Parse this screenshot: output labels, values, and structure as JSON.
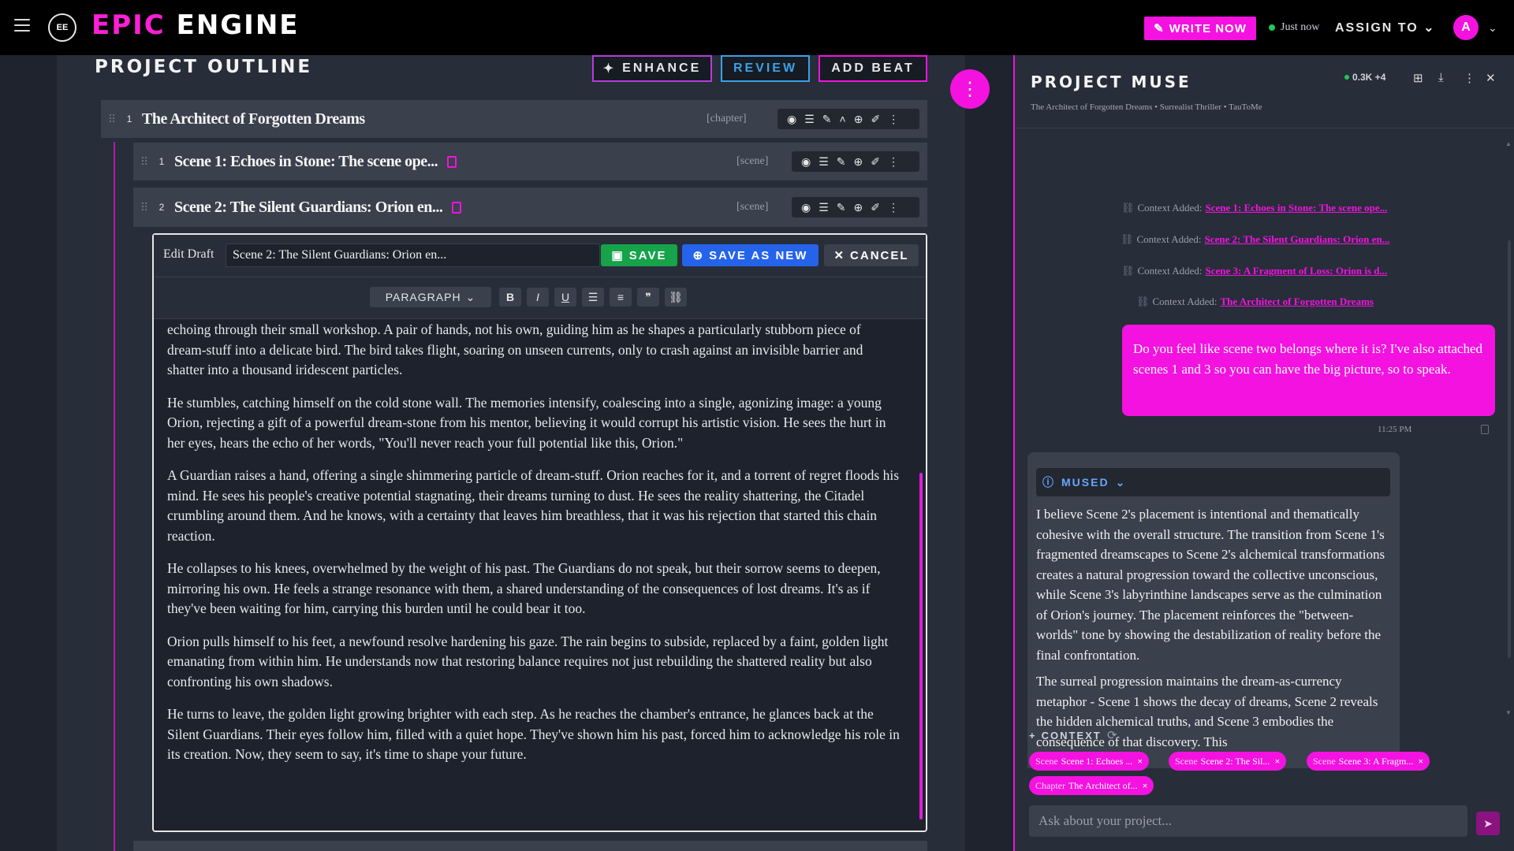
{
  "brand": {
    "logo_text": "EE",
    "part1": "EPIC",
    "part2": "ENGINE"
  },
  "topbar": {
    "write_now": "WRITE NOW",
    "status": "Just now",
    "assign": "ASSIGN TO",
    "avatar": "A"
  },
  "outline": {
    "title": "PROJECT OUTLINE",
    "enhance": "ENHANCE",
    "review": "REVIEW",
    "add_beat": "ADD BEAT",
    "chapter": {
      "num": "1",
      "title": "The Architect of Forgotten Dreams",
      "tag": "[chapter]"
    },
    "scenes": [
      {
        "num": "1",
        "title": "Scene 1: Echoes in Stone: The scene ope...",
        "tag": "[scene]"
      },
      {
        "num": "2",
        "title": "Scene 2: The Silent Guardians: Orion en...",
        "tag": "[scene]"
      }
    ]
  },
  "editor": {
    "label": "Edit Draft",
    "input_value": "Scene 2: The Silent Guardians: Orion en...",
    "save": "SAVE",
    "save_as_new": "SAVE AS NEW",
    "cancel": "CANCEL",
    "paragraph": "PARAGRAPH",
    "paragraphs": [
      "echoing through their small workshop. A pair of hands, not his own, guiding him as he shapes a particularly stubborn piece of dream-stuff into a delicate bird. The bird takes flight, soaring on unseen currents, only to crash against an invisible barrier and shatter into a thousand iridescent particles.",
      "He stumbles, catching himself on the cold stone wall. The memories intensify, coalescing into a single, agonizing image: a young Orion, rejecting a gift of a powerful dream-stone from his mentor, believing it would corrupt his artistic vision. He sees the hurt in her eyes, hears the echo of her words, \"You'll never reach your full potential like this, Orion.\"",
      "A Guardian raises a hand, offering a single shimmering particle of dream-stuff. Orion reaches for it, and a torrent of regret floods his mind. He sees his people's creative potential stagnating, their dreams turning to dust. He sees the reality shattering, the Citadel crumbling around them. And he knows, with a certainty that leaves him breathless, that it was his rejection that started this chain reaction.",
      "He collapses to his knees, overwhelmed by the weight of his past. The Guardians do not speak, but their sorrow seems to deepen, mirroring his own. He feels a strange resonance with them, a shared understanding of the consequences of lost dreams. It's as if they've been waiting for him, carrying this burden until he could bear it too.",
      "Orion pulls himself to his feet, a newfound resolve hardening his gaze. The rain begins to subside, replaced by a faint, golden light emanating from within him. He understands now that restoring balance requires not just rebuilding the shattered reality but also confronting his own shadows.",
      "He turns to leave, the golden light growing brighter with each step. As he reaches the chamber's entrance, he glances back at the Silent Guardians. Their eyes follow him, filled with a quiet hope. They've shown him his past, forced him to acknowledge his role in its creation. Now, they seem to say, it's time to shape your future."
    ]
  },
  "muse": {
    "title": "PROJECT MUSE",
    "subtitle": "The Architect of Forgotten Dreams • Surrealist Thriller • TauToMe",
    "stats": "0.3K +4",
    "context_added_label": "Context Added:",
    "context_links": [
      "Scene 1: Echoes in Stone: The scene ope...",
      "Scene 2: The Silent Guardians: Orion en...",
      "Scene 3: A Fragment of Loss: Orion is d...",
      "The Architect of Forgotten Dreams"
    ],
    "user_message": "Do you feel like scene two belongs where it is? I've also attached scenes 1 and 3 so you can have the big picture, so to speak.",
    "time": "11:25 PM",
    "bot_label": "MUSED",
    "bot_paragraphs": [
      "I believe Scene 2's placement is intentional and thematically cohesive with the overall structure. The transition from Scene 1's fragmented dreamscapes to Scene 2's alchemical transformations creates a natural progression toward the collective unconscious, while Scene 3's labyrinthine landscapes serve as the culmination of Orion's journey. The placement reinforces the \"between-worlds\" tone by showing the destabilization of reality before the final confrontation.",
      "The surreal progression maintains the dream-as-currency metaphor - Scene 1 shows the decay of dreams, Scene 2 reveals the hidden alchemical truths, and Scene 3 embodies the consequence of that discovery. This"
    ],
    "context_header": "CONTEXT",
    "chips": [
      {
        "kind": "Scene",
        "label": "Scene 1: Echoes ..."
      },
      {
        "kind": "Scene",
        "label": "Scene 2: The Sil..."
      },
      {
        "kind": "Scene",
        "label": "Scene 3: A Fragm..."
      },
      {
        "kind": "Chapter",
        "label": "The Architect of..."
      }
    ],
    "ask_placeholder": "Ask about your project..."
  },
  "colors": {
    "accent": "#f312e0",
    "save": "#16a34a",
    "save_as_new": "#2563eb",
    "review": "#3aa2e6"
  }
}
